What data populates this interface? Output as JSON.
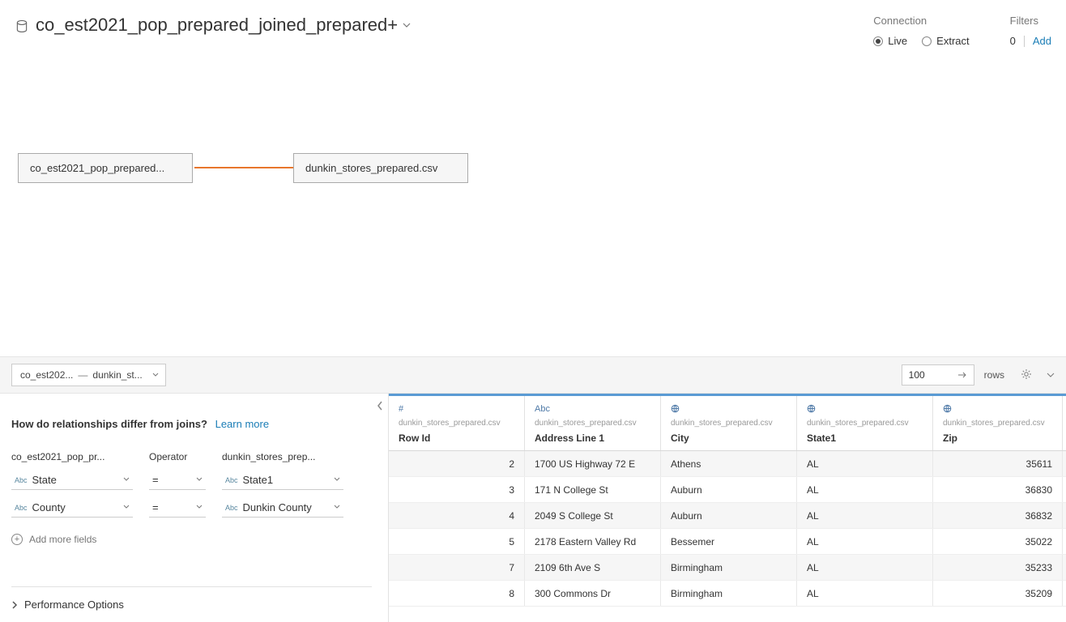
{
  "header": {
    "datasource_title": "co_est2021_pop_prepared_joined_prepared+",
    "connection_label": "Connection",
    "live_label": "Live",
    "extract_label": "Extract",
    "filters_label": "Filters",
    "filters_count": "0",
    "filters_add": "Add"
  },
  "canvas": {
    "left_table": "co_est2021_pop_prepared...",
    "right_table": "dunkin_stores_prepared.csv"
  },
  "divider": {
    "crumb_left": "co_est202...",
    "crumb_sep": "—",
    "crumb_right": "dunkin_st...",
    "row_count": "100",
    "rows_label": "rows"
  },
  "relationship": {
    "question": "How do relationships differ from joins?",
    "learn_more": "Learn more",
    "col_left_header": "co_est2021_pop_pr...",
    "col_op_header": "Operator",
    "col_right_header": "dunkin_stores_prep...",
    "rows": [
      {
        "left": "State",
        "op": "=",
        "right": "State1"
      },
      {
        "left": "County",
        "op": "=",
        "right": "Dunkin County"
      }
    ],
    "add_more": "Add more fields",
    "perf_options": "Performance Options"
  },
  "grid": {
    "source_name": "dunkin_stores_prepared.csv",
    "columns": [
      {
        "key": "rowid",
        "name": "Row Id",
        "type": "number"
      },
      {
        "key": "addr",
        "name": "Address Line 1",
        "type": "string"
      },
      {
        "key": "city",
        "name": "City",
        "type": "geo"
      },
      {
        "key": "state",
        "name": "State1",
        "type": "geo"
      },
      {
        "key": "zip",
        "name": "Zip",
        "type": "geo"
      }
    ],
    "rows": [
      {
        "rowid": "2",
        "addr": "1700 US Highway 72 E",
        "city": "Athens",
        "state": "AL",
        "zip": "35611"
      },
      {
        "rowid": "3",
        "addr": "171 N College St",
        "city": "Auburn",
        "state": "AL",
        "zip": "36830"
      },
      {
        "rowid": "4",
        "addr": "2049 S College St",
        "city": "Auburn",
        "state": "AL",
        "zip": "36832"
      },
      {
        "rowid": "5",
        "addr": "2178 Eastern Valley Rd",
        "city": "Bessemer",
        "state": "AL",
        "zip": "35022"
      },
      {
        "rowid": "7",
        "addr": "2109 6th Ave S",
        "city": "Birmingham",
        "state": "AL",
        "zip": "35233"
      },
      {
        "rowid": "8",
        "addr": "300 Commons Dr",
        "city": "Birmingham",
        "state": "AL",
        "zip": "35209"
      }
    ]
  }
}
